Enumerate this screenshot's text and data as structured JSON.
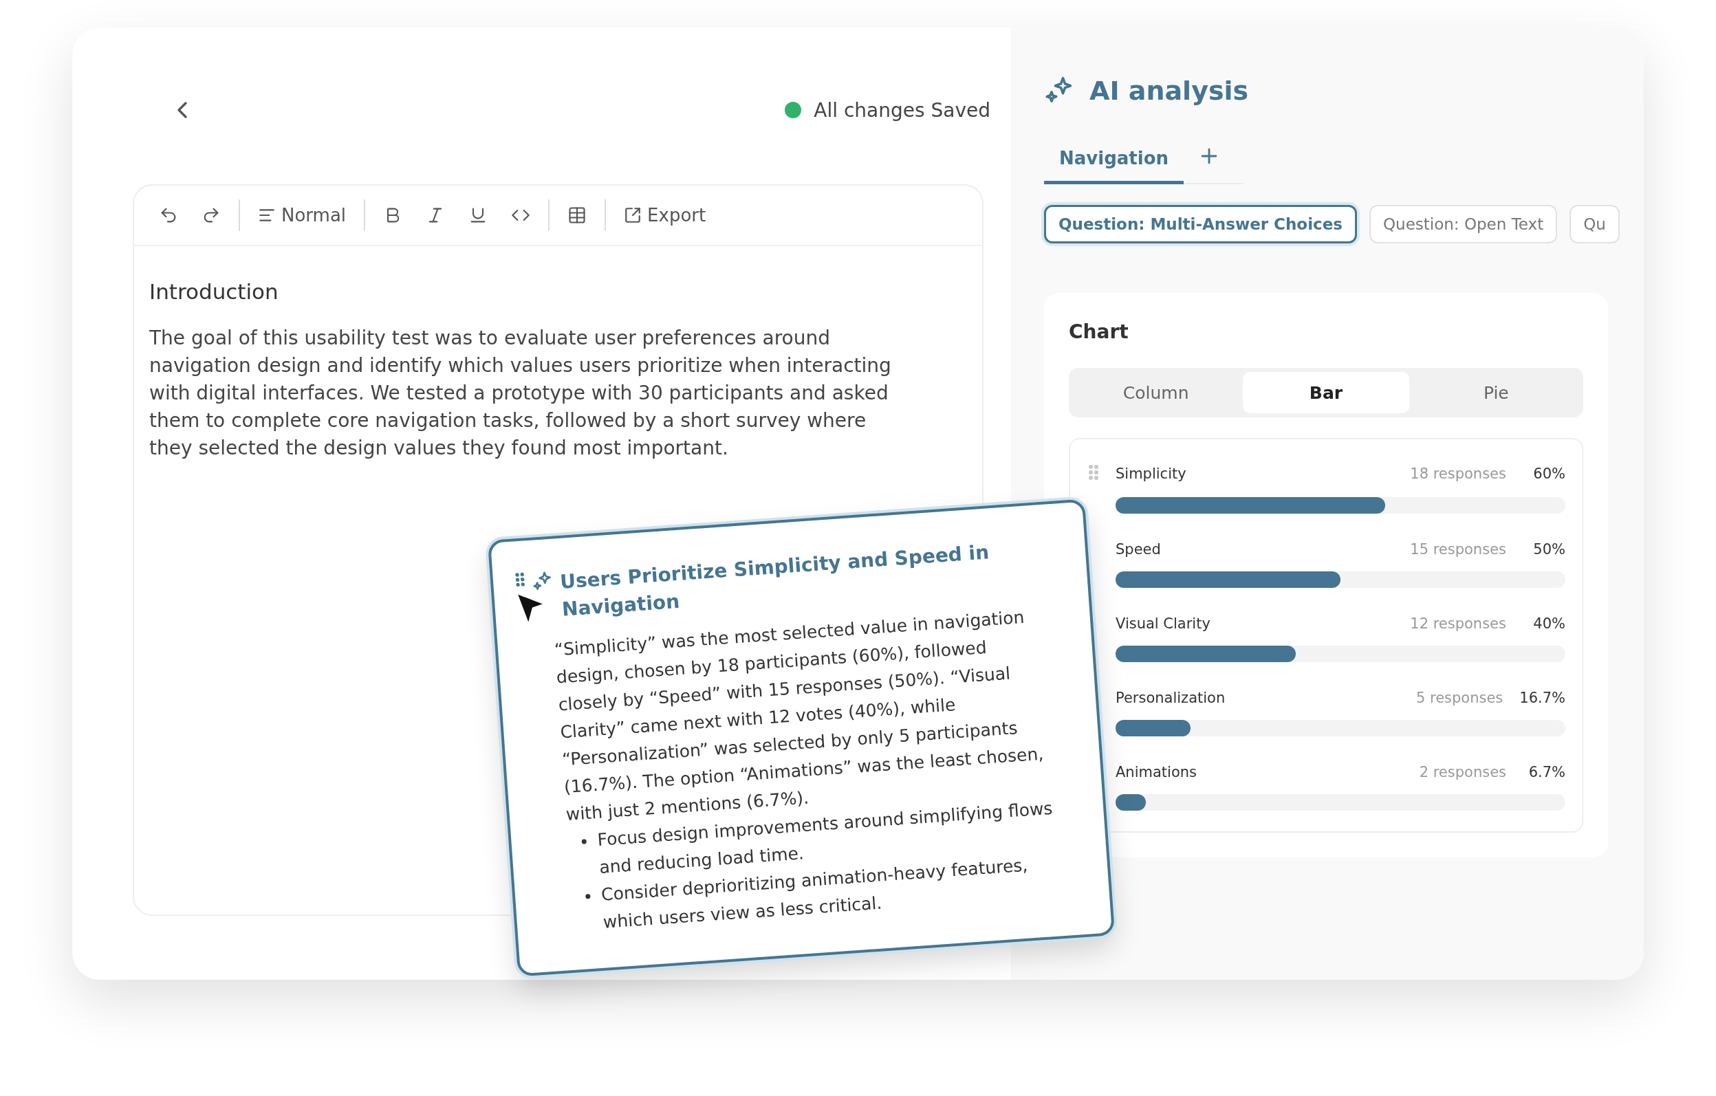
{
  "editor": {
    "status": {
      "label": "All changes Saved",
      "saved": true
    },
    "toolbar": {
      "style": "Normal",
      "export": "Export"
    },
    "heading": "Introduction",
    "paragraph": "The goal of this usability test was to evaluate user preferences around navigation design and identify which values users prioritize when interacting with digital interfaces. We tested a prototype with 30 participants and asked them to complete core navigation tasks, followed by a short survey where they selected the design values they found most important."
  },
  "insight_card": {
    "title": "Users Prioritize Simplicity and Speed in Navigation",
    "body": "“Simplicity” was the most selected value in navigation design, chosen by 18 participants (60%), followed closely by “Speed” with 15 responses (50%). “Visual Clarity” came next with 12 votes (40%), while “Personalization” was selected by only 5 participants (16.7%). The option “Animations” was the least chosen, with just 2 mentions (6.7%).",
    "bullets": [
      "Focus design improvements around simplifying flows and reducing load time.",
      "Consider deprioritizing animation-heavy features, which users view as less critical."
    ]
  },
  "analysis": {
    "title": "AI analysis",
    "tabs": [
      {
        "label": "Navigation",
        "selected": true
      }
    ],
    "questions": [
      {
        "label": "Question: Multi-Answer Choices",
        "selected": true
      },
      {
        "label": "Question: Open Text",
        "selected": false
      },
      {
        "label": "Qu",
        "selected": false
      }
    ],
    "chart": {
      "title": "Chart",
      "types": [
        {
          "label": "Column",
          "selected": false
        },
        {
          "label": "Bar",
          "selected": true
        },
        {
          "label": "Pie",
          "selected": false
        }
      ],
      "items": [
        {
          "name": "Simplicity",
          "responses": "18 responses",
          "percent": "60%",
          "level": 0.6
        },
        {
          "name": "Speed",
          "responses": "15 responses",
          "percent": "50%",
          "level": 0.5
        },
        {
          "name": "Visual Clarity",
          "responses": "12 responses",
          "percent": "40%",
          "level": 0.4
        },
        {
          "name": "Personalization",
          "responses": "5 responses",
          "percent": "16.7%",
          "level": 0.167
        },
        {
          "name": "Animations",
          "responses": "2 responses",
          "percent": "6.7%",
          "level": 0.067
        }
      ]
    }
  }
}
